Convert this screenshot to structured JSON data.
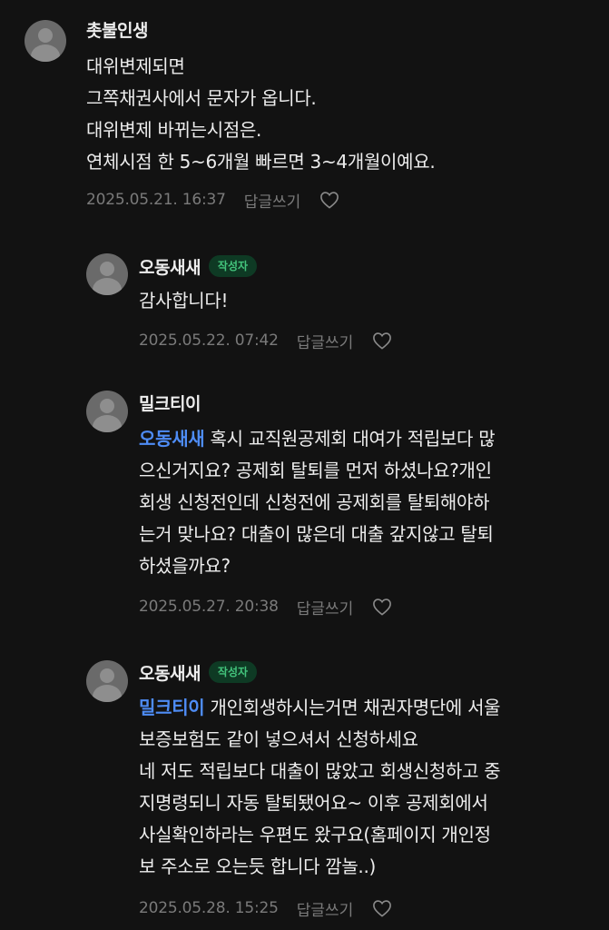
{
  "comments": [
    {
      "author": "촛불인생",
      "badge": "",
      "mention": "",
      "lines": [
        "대위변제되면",
        "그쪽채권사에서 문자가 옵니다.",
        "대위변제 바뀌는시점은.",
        "연체시점 한 5~6개월 빠르면 3~4개월이예요."
      ],
      "date": "2025.05.21. 16:37",
      "reply_label": "답글쓰기"
    },
    {
      "author": "오동새새",
      "badge": "작성자",
      "mention": "",
      "lines": [
        "감사합니다!"
      ],
      "date": "2025.05.22. 07:42",
      "reply_label": "답글쓰기"
    },
    {
      "author": "밀크티이",
      "badge": "",
      "mention": "오동새새",
      "first_line_rest": " 혹시 교직원공제회 대여가 적립보다 많",
      "lines": [
        "으신거지요? 공제회 탈퇴를 먼저 하셨나요?개인",
        "회생 신청전인데 신청전에 공제회를 탈퇴해야하",
        "는거 맞나요? 대출이 많은데 대출 갚지않고 탈퇴",
        "하셨을까요?"
      ],
      "date": "2025.05.27. 20:38",
      "reply_label": "답글쓰기"
    },
    {
      "author": "오동새새",
      "badge": "작성자",
      "mention": "밀크티이",
      "first_line_rest": " 개인회생하시는거면 채권자명단에 서울",
      "lines": [
        "보증보험도 같이 넣으셔서 신청하세요",
        "네 저도 적립보다 대출이 많았고 회생신청하고 중",
        "지명령되니 자동 탈퇴됐어요~ 이후 공제회에서",
        "사실확인하라는 우편도 왔구요(홈페이지 개인정",
        "보 주소로 오는듯 합니다 깜놀..)"
      ],
      "date": "2025.05.28. 15:25",
      "reply_label": "답글쓰기"
    }
  ],
  "icons": {
    "avatar": "default-user-avatar",
    "like": "heart-outline-icon"
  },
  "colors": {
    "background": "#121212",
    "mention": "#4e8cf5",
    "badge_text": "#43c47c",
    "badge_bg": "#0e3a24",
    "meta": "#7a7a7a"
  }
}
